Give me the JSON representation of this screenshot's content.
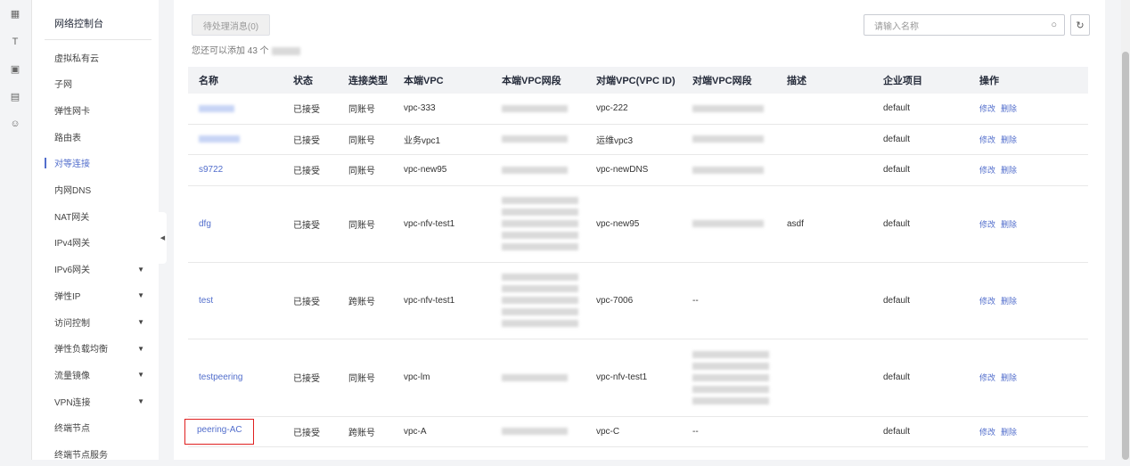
{
  "rail_icons": [
    "grid-icon",
    "font-icon",
    "image-icon",
    "picture-icon",
    "smile-icon"
  ],
  "sidebar": {
    "title": "网络控制台",
    "items": [
      {
        "label": "虚拟私有云",
        "active": false,
        "expandable": false
      },
      {
        "label": "子网",
        "active": false,
        "expandable": false
      },
      {
        "label": "弹性网卡",
        "active": false,
        "expandable": false
      },
      {
        "label": "路由表",
        "active": false,
        "expandable": false
      },
      {
        "label": "对等连接",
        "active": true,
        "expandable": false
      },
      {
        "label": "内网DNS",
        "active": false,
        "expandable": false
      },
      {
        "label": "NAT网关",
        "active": false,
        "expandable": false
      },
      {
        "label": "IPv4网关",
        "active": false,
        "expandable": false
      },
      {
        "label": "IPv6网关",
        "active": false,
        "expandable": true
      },
      {
        "label": "弹性IP",
        "active": false,
        "expandable": true
      },
      {
        "label": "访问控制",
        "active": false,
        "expandable": true
      },
      {
        "label": "弹性负载均衡",
        "active": false,
        "expandable": true
      },
      {
        "label": "流量镜像",
        "active": false,
        "expandable": true
      },
      {
        "label": "VPN连接",
        "active": false,
        "expandable": true
      },
      {
        "label": "终端节点",
        "active": false,
        "expandable": false
      },
      {
        "label": "终端节点服务",
        "active": false,
        "expandable": false
      }
    ]
  },
  "toolbar": {
    "pending_label": "待处理消息(0)",
    "quota_text": "您还可以添加 43 个",
    "search_placeholder": "请输入名称"
  },
  "table": {
    "columns": [
      "名称",
      "状态",
      "连接类型",
      "本端VPC",
      "本端VPC网段",
      "对端VPC(VPC ID)",
      "对端VPC网段",
      "描述",
      "企业项目",
      "操作"
    ],
    "actions": [
      "修改",
      "删除"
    ],
    "rows": [
      {
        "name": "",
        "status": "已接受",
        "type": "同账号",
        "local_vpc": "vpc-333",
        "peer_vpc": "vpc-222",
        "desc": "",
        "project": "default"
      },
      {
        "name": "",
        "status": "已接受",
        "type": "同账号",
        "local_vpc": "业务vpc1",
        "peer_vpc": "运维vpc3",
        "desc": "",
        "project": "default"
      },
      {
        "name": "s9722",
        "status": "已接受",
        "type": "同账号",
        "local_vpc": "vpc-new95",
        "peer_vpc": "vpc-newDNS",
        "desc": "",
        "project": "default"
      },
      {
        "name": "dfg",
        "status": "已接受",
        "type": "同账号",
        "local_vpc": "vpc-nfv-test1",
        "peer_vpc": "vpc-new95",
        "desc": "asdf",
        "project": "default"
      },
      {
        "name": "test",
        "status": "已接受",
        "type": "跨账号",
        "local_vpc": "vpc-nfv-test1",
        "peer_vpc": "vpc-7006",
        "peer_cidr": "--",
        "desc": "",
        "project": "default"
      },
      {
        "name": "testpeering",
        "status": "已接受",
        "type": "同账号",
        "local_vpc": "vpc-lm",
        "peer_vpc": "vpc-nfv-test1",
        "desc": "",
        "project": "default"
      },
      {
        "name": "peering-AC",
        "status": "已接受",
        "type": "跨账号",
        "local_vpc": "vpc-A",
        "peer_vpc": "vpc-C",
        "peer_cidr": "--",
        "desc": "",
        "project": "default"
      }
    ]
  },
  "colors": {
    "link": "#526ecc",
    "highlight_border": "#e02020",
    "header_bg": "#f2f3f5"
  }
}
